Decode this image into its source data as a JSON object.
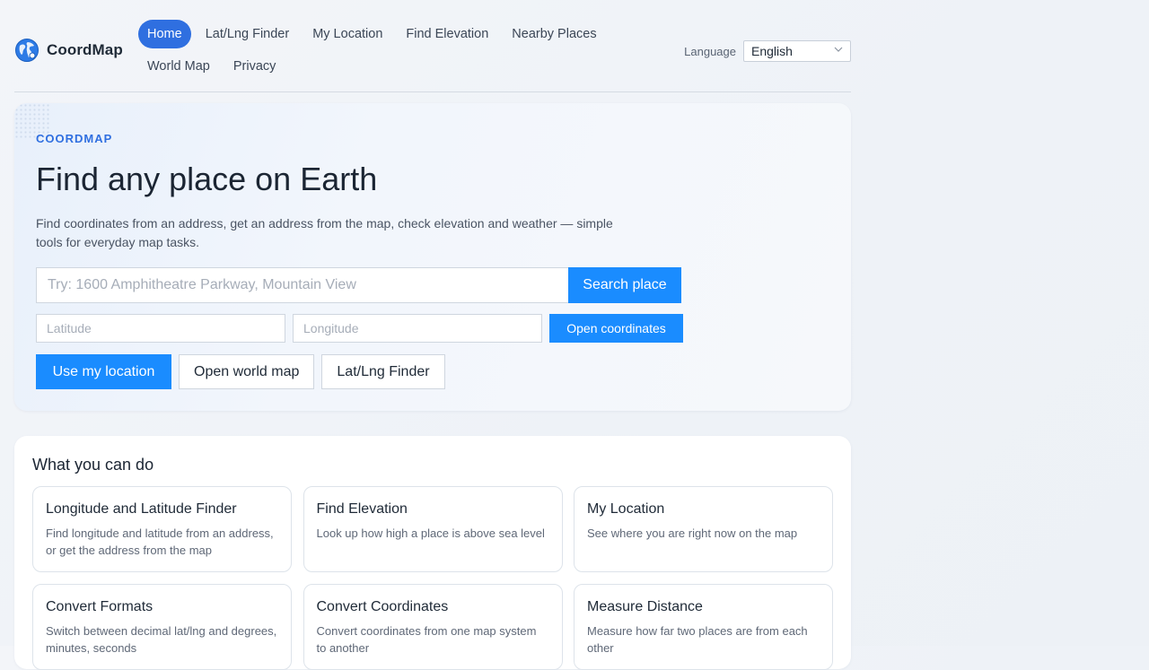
{
  "brand": {
    "name": "CoordMap"
  },
  "nav": {
    "items": [
      {
        "label": "Home",
        "active": true
      },
      {
        "label": "Lat/Lng Finder"
      },
      {
        "label": "My Location"
      },
      {
        "label": "Find Elevation"
      },
      {
        "label": "Nearby Places"
      },
      {
        "label": "World Map"
      },
      {
        "label": "Privacy"
      }
    ]
  },
  "language": {
    "label": "Language",
    "selected": "English"
  },
  "hero": {
    "eyebrow": "COORDMAP",
    "title": "Find any place on Earth",
    "description": "Find coordinates from an address, get an address from the map, check elevation and weather — simple tools for everyday map tasks.",
    "search_placeholder": "Try: 1600 Amphitheatre Parkway, Mountain View",
    "search_button": "Search place",
    "lat_placeholder": "Latitude",
    "lng_placeholder": "Longitude",
    "open_coords_button": "Open coordinates",
    "use_location_button": "Use my location",
    "world_map_button": "Open world map",
    "finder_button": "Lat/Lng Finder"
  },
  "features": {
    "title": "What you can do",
    "cards": [
      {
        "title": "Longitude and Latitude Finder",
        "desc": "Find longitude and latitude from an address, or get the address from the map"
      },
      {
        "title": "Find Elevation",
        "desc": "Look up how high a place is above sea level"
      },
      {
        "title": "My Location",
        "desc": "See where you are right now on the map"
      },
      {
        "title": "Convert Formats",
        "desc": "Switch between decimal lat/lng and degrees, minutes, seconds"
      },
      {
        "title": "Convert Coordinates",
        "desc": "Convert coordinates from one map system to another"
      },
      {
        "title": "Measure Distance",
        "desc": "Measure how far two places are from each other"
      }
    ]
  },
  "colors": {
    "accent": "#1a8cff",
    "nav_active": "#2f6fe0"
  }
}
